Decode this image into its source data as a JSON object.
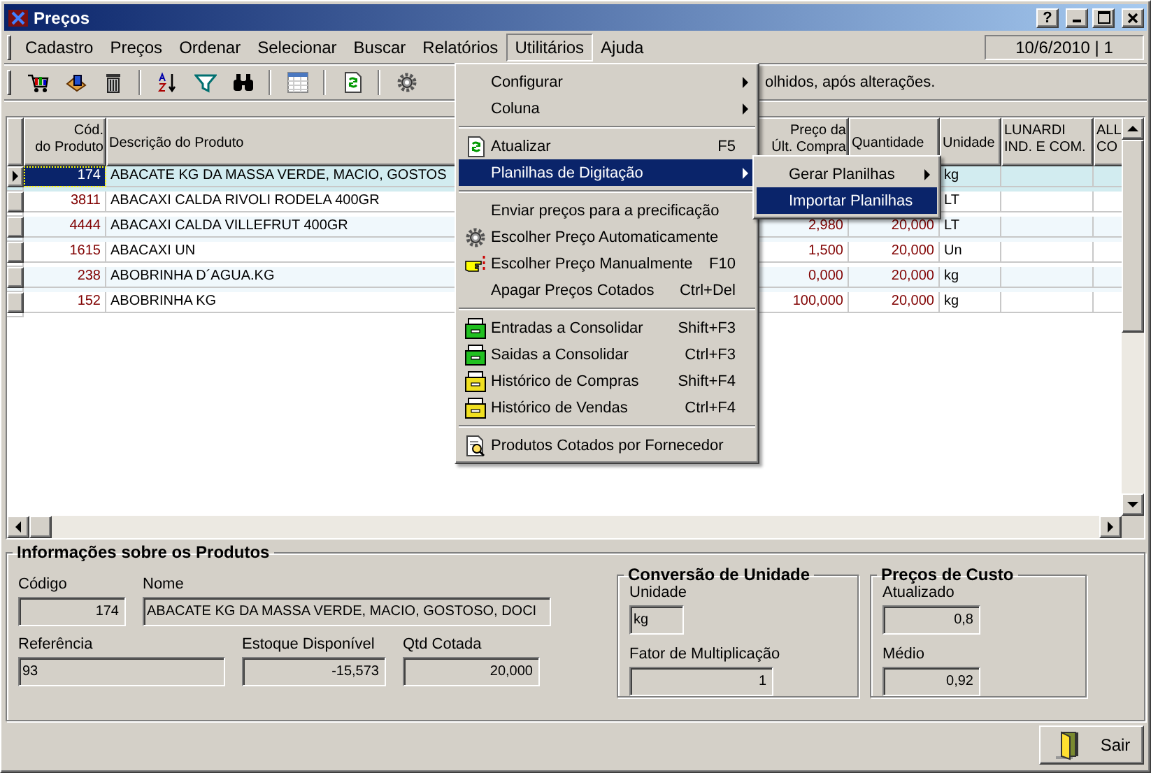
{
  "window": {
    "title": "Preços",
    "help_button": "?"
  },
  "menu": [
    {
      "label": "Cadastro",
      "open": false
    },
    {
      "label": "Preços",
      "open": false
    },
    {
      "label": "Ordenar",
      "open": false
    },
    {
      "label": "Selecionar",
      "open": false
    },
    {
      "label": "Buscar",
      "open": false
    },
    {
      "label": "Relatórios",
      "open": false
    },
    {
      "label": "Utilitários",
      "open": true
    },
    {
      "label": "Ajuda",
      "open": false
    }
  ],
  "session": "10/6/2010 | 1",
  "toolbar_hint": "olhidos, após alterações.",
  "grid": {
    "columns": [
      "Cód.\ndo Produto",
      "Descrição do Produto",
      "Preço da\nÚlt. Compra",
      "Quantidade",
      "Unidade",
      "LUNARDI\nIND. E COM.",
      "ALL\nCO"
    ],
    "rows": [
      {
        "code": "174",
        "description": "ABACATE KG DA MASSA VERDE, MACIO, GOSTOS",
        "unit": "kg",
        "selected": true
      },
      {
        "code": "3811",
        "description": "ABACAXI CALDA RIVOLI RODELA 400GR",
        "unit": "LT",
        "selected": false
      },
      {
        "code": "4444",
        "description": "ABACAXI CALDA VILLEFRUT 400GR",
        "last_price": "2,980",
        "quantity": "20,000",
        "unit": "LT",
        "selected": false
      },
      {
        "code": "1615",
        "description": "ABACAXI UN",
        "last_price": "1,500",
        "quantity": "20,000",
        "unit": "Un",
        "selected": false
      },
      {
        "code": "238",
        "description": "ABOBRINHA D´AGUA.KG",
        "last_price": "0,000",
        "quantity": "20,000",
        "unit": "kg",
        "selected": false
      },
      {
        "code": "152",
        "description": "ABOBRINHA KG",
        "last_price": "100,000",
        "quantity": "20,000",
        "unit": "kg",
        "selected": false
      }
    ]
  },
  "dropdown": [
    {
      "kind": "item",
      "label": "Configurar",
      "submenu": true,
      "selected": false
    },
    {
      "kind": "item",
      "label": "Coluna",
      "submenu": true,
      "selected": false
    },
    {
      "kind": "separator"
    },
    {
      "kind": "item",
      "label": "Atualizar",
      "shortcut": "F5",
      "selected": false
    },
    {
      "kind": "item",
      "label": "Planilhas de Digitação",
      "submenu": true,
      "selected": true
    },
    {
      "kind": "separator"
    },
    {
      "kind": "item",
      "label": "Enviar preços para a precificação",
      "selected": false
    },
    {
      "kind": "item",
      "label": "Escolher Preço Automaticamente",
      "selected": false
    },
    {
      "kind": "item",
      "label": "Escolher Preço Manualmente",
      "shortcut": "F10",
      "selected": false
    },
    {
      "kind": "item",
      "label": "Apagar Preços Cotados",
      "shortcut": "Ctrl+Del",
      "selected": false
    },
    {
      "kind": "separator"
    },
    {
      "kind": "item",
      "label": "Entradas a Consolidar",
      "shortcut": "Shift+F3",
      "selected": false
    },
    {
      "kind": "item",
      "label": "Saidas a Consolidar",
      "shortcut": "Ctrl+F3",
      "selected": false
    },
    {
      "kind": "item",
      "label": "Histórico de Compras",
      "shortcut": "Shift+F4",
      "selected": false
    },
    {
      "kind": "item",
      "label": "Histórico de Vendas",
      "shortcut": "Ctrl+F4",
      "selected": false
    },
    {
      "kind": "separator"
    },
    {
      "kind": "item",
      "label": "Produtos Cotados por Fornecedor",
      "selected": false
    }
  ],
  "submenu": [
    {
      "label": "Gerar Planilhas",
      "submenu": true,
      "selected": false
    },
    {
      "label": "Importar Planilhas",
      "selected": true
    }
  ],
  "product_info": {
    "title": "Informações sobre os Produtos",
    "code": {
      "label": "Código",
      "value": "174"
    },
    "name": {
      "label": "Nome",
      "value": "ABACATE KG DA MASSA VERDE, MACIO, GOSTOSO, DOCI"
    },
    "reference": {
      "label": "Referência",
      "value": "93"
    },
    "stock": {
      "label": "Estoque Disponível",
      "value": "-15,573"
    },
    "quoted_qty": {
      "label": "Qtd Cotada",
      "value": "20,000"
    }
  },
  "unit_conversion": {
    "title": "Conversão de Unidade",
    "unit": {
      "label": "Unidade",
      "value": "kg"
    },
    "factor": {
      "label": "Fator de Multiplicação",
      "value": "1"
    }
  },
  "cost_prices": {
    "title": "Preços de Custo",
    "updated": {
      "label": "Atualizado",
      "value": "0,8"
    },
    "average": {
      "label": "Médio",
      "value": "0,92"
    }
  },
  "exit_button": "Sair"
}
